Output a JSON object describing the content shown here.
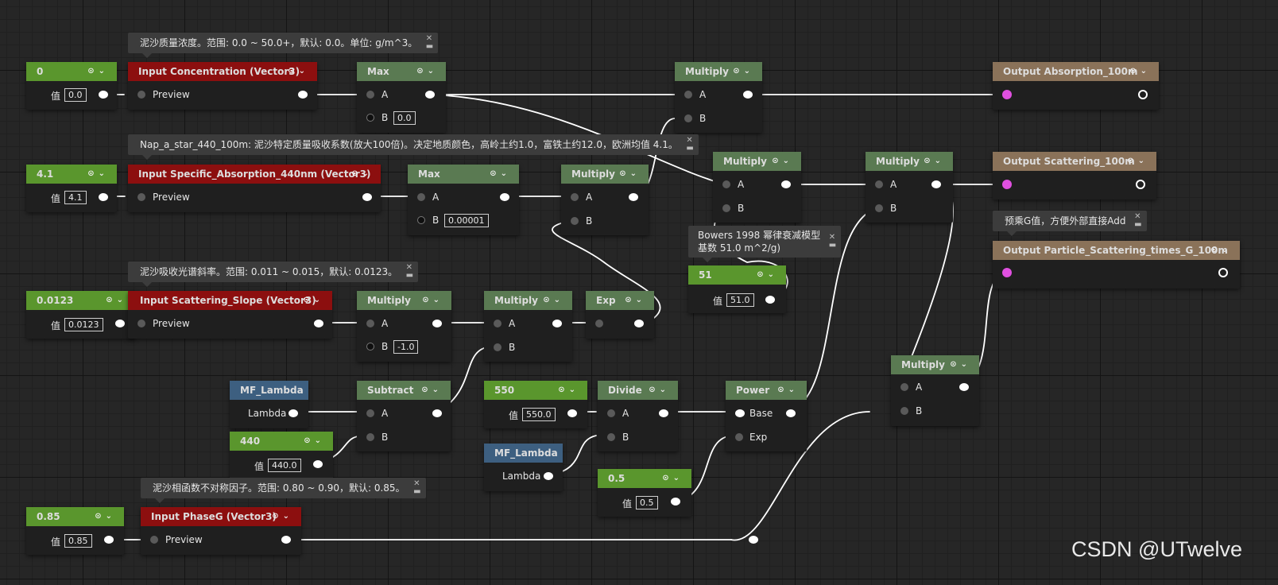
{
  "comments": {
    "concentration": "泥沙质量浓度。范围: 0.0 ~ 50.0+，默认: 0.0。单位: g/m^3。",
    "absorption": "Nap_a_star_440_100m: 泥沙特定质量吸收系数(放大100倍)。决定地质颜色，高岭土约1.0，富铁土约12.0，欧洲均值 4.1。",
    "slope": "泥沙吸收光谱斜率。范围: 0.011 ~ 0.015，默认: 0.0123。",
    "phase": "泥沙相函数不对称因子。范围: 0.80 ~ 0.90，默认: 0.85。",
    "bowers_line1": "Bowers 1998 幂律衰减模型",
    "bowers_line2": "基数 51.0 m^2/g)",
    "premul": "预乘G值，方便外部直接Add"
  },
  "nodes": {
    "const_concentration": {
      "title": "0",
      "value_label": "值",
      "value": "0.0"
    },
    "input_concentration": {
      "title": "Input Concentration (Vector3)",
      "pin": "Preview"
    },
    "max1": {
      "title": "Max",
      "a": "A",
      "b": "B",
      "b_value": "0.0"
    },
    "multiply_abs": {
      "title": "Multiply",
      "a": "A",
      "b": "B"
    },
    "output_absorption": {
      "title": "Output Absorption_100m"
    },
    "const_specific": {
      "title": "4.1",
      "value_label": "值",
      "value": "4.1"
    },
    "input_specific": {
      "title": "Input Specific_Absorption_440nm (Vector3)",
      "pin": "Preview"
    },
    "max2": {
      "title": "Max",
      "a": "A",
      "b": "B",
      "b_value": "0.00001"
    },
    "multiply_spec": {
      "title": "Multiply",
      "a": "A",
      "b": "B"
    },
    "multiply_mid": {
      "title": "Multiply",
      "a": "A",
      "b": "B"
    },
    "multiply_scat": {
      "title": "Multiply",
      "a": "A",
      "b": "B"
    },
    "output_scattering": {
      "title": "Output Scattering_100m"
    },
    "output_particle": {
      "title": "Output Particle_Scattering_times_G_100m"
    },
    "const_51": {
      "title": "51",
      "value_label": "值",
      "value": "51.0"
    },
    "const_slope": {
      "title": "0.0123",
      "value_label": "值",
      "value": "0.0123"
    },
    "input_slope": {
      "title": "Input Scattering_Slope (Vector3)",
      "pin": "Preview"
    },
    "multiply_slope": {
      "title": "Multiply",
      "a": "A",
      "b": "B",
      "b_value": "-1.0"
    },
    "multiply_slope2": {
      "title": "Multiply",
      "a": "A",
      "b": "B"
    },
    "exp": {
      "title": "Exp"
    },
    "mf_lambda1": {
      "title": "MF_Lambda",
      "pin": "Lambda"
    },
    "subtract": {
      "title": "Subtract",
      "a": "A",
      "b": "B"
    },
    "const_440": {
      "title": "440",
      "value_label": "值",
      "value": "440.0"
    },
    "const_550": {
      "title": "550",
      "value_label": "值",
      "value": "550.0"
    },
    "divide": {
      "title": "Divide",
      "a": "A",
      "b": "B"
    },
    "power": {
      "title": "Power",
      "base": "Base",
      "exp": "Exp"
    },
    "mf_lambda2": {
      "title": "MF_Lambda",
      "pin": "Lambda"
    },
    "const_05": {
      "title": "0.5",
      "value_label": "值",
      "value": "0.5"
    },
    "multiply_g": {
      "title": "Multiply",
      "a": "A",
      "b": "B"
    },
    "const_085": {
      "title": "0.85",
      "value_label": "值",
      "value": "0.85"
    },
    "input_phase": {
      "title": "Input PhaseG (Vector3)",
      "pin": "Preview"
    }
  },
  "watermark": "CSDN @UTwelve",
  "colors": {
    "param_header": "#5a962d",
    "math_header": "#5a7a52",
    "input_header": "#8c0f0f",
    "function_header": "#3d5f80",
    "output_header": "#8a7259",
    "output_pin": "#e050e0",
    "wire": "#ffffff"
  }
}
